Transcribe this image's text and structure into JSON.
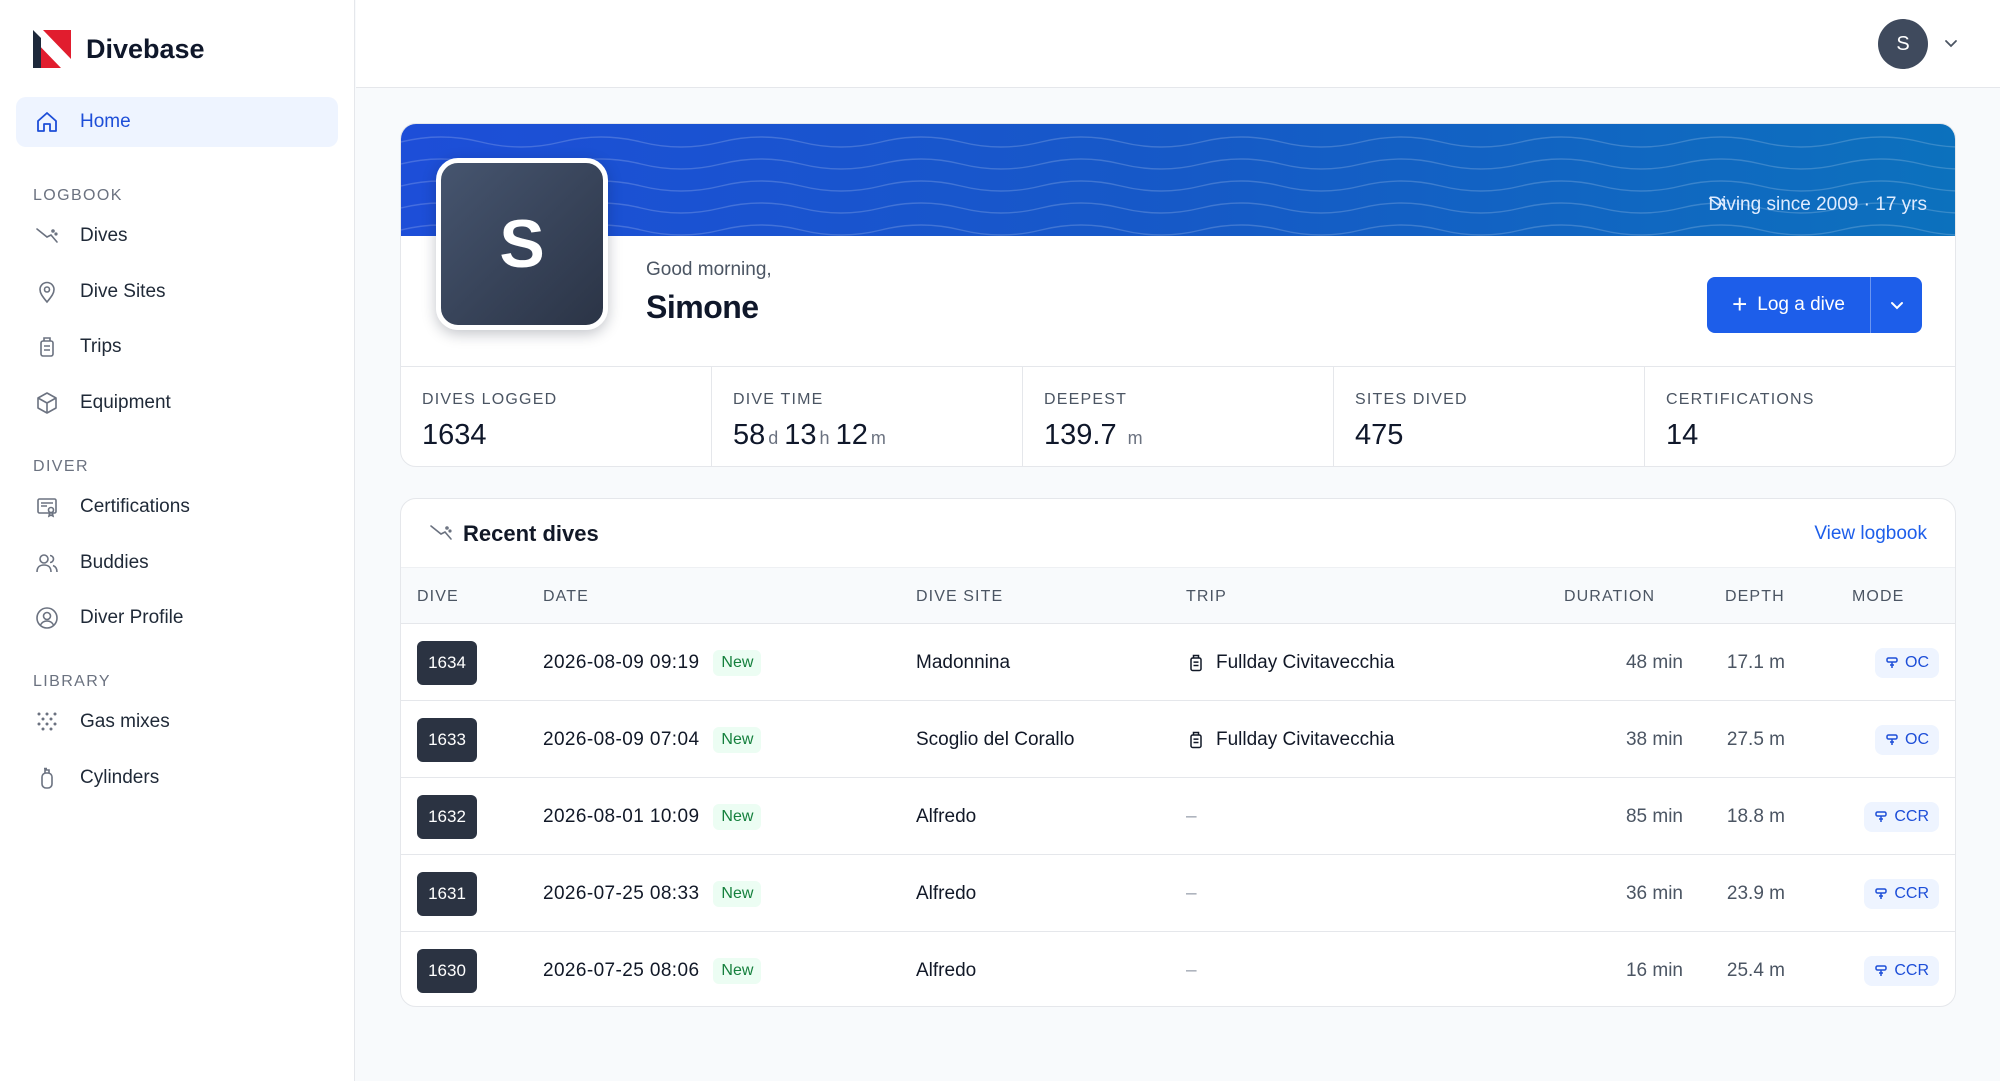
{
  "app": {
    "name": "Divebase"
  },
  "sidebar": {
    "home": {
      "label": "Home",
      "icon": "home-icon"
    },
    "sections": [
      {
        "title": "LOGBOOK",
        "items": [
          {
            "label": "Dives",
            "icon": "dive-icon"
          },
          {
            "label": "Dive Sites",
            "icon": "map-pin-icon"
          },
          {
            "label": "Trips",
            "icon": "luggage-icon"
          },
          {
            "label": "Equipment",
            "icon": "box-icon"
          }
        ]
      },
      {
        "title": "DIVER",
        "items": [
          {
            "label": "Certifications",
            "icon": "certificate-icon"
          },
          {
            "label": "Buddies",
            "icon": "users-icon"
          },
          {
            "label": "Diver Profile",
            "icon": "user-circle-icon"
          }
        ]
      },
      {
        "title": "LIBRARY",
        "items": [
          {
            "label": "Gas mixes",
            "icon": "gas-dots-icon"
          },
          {
            "label": "Cylinders",
            "icon": "cylinder-icon"
          }
        ]
      }
    ]
  },
  "topbar": {
    "avatar_initial": "S"
  },
  "profile": {
    "diving_since": "Diving since 2009 · 17 yrs",
    "avatar_initial": "S",
    "greeting": "Good morning,",
    "name": "Simone",
    "log_button": "Log a dive",
    "stats": [
      {
        "label": "DIVES LOGGED",
        "value": "1634"
      },
      {
        "label": "DIVE TIME",
        "parts": [
          [
            "58",
            "d"
          ],
          [
            "13",
            "h"
          ],
          [
            "12",
            "m"
          ]
        ]
      },
      {
        "label": "DEEPEST",
        "value": "139.7",
        "unit": "m"
      },
      {
        "label": "SITES DIVED",
        "value": "475"
      },
      {
        "label": "CERTIFICATIONS",
        "value": "14"
      }
    ]
  },
  "recent": {
    "title": "Recent dives",
    "view_link": "View logbook",
    "columns": {
      "dive": "DIVE",
      "date": "DATE",
      "site": "DIVE SITE",
      "trip": "TRIP",
      "duration": "DURATION",
      "depth": "DEPTH",
      "mode": "MODE"
    },
    "rows": [
      {
        "num": "1634",
        "date": "2026-08-09 09:19",
        "badge": "New",
        "site": "Madonnina",
        "trip": "Fullday Civitavecchia",
        "duration": "48 min",
        "depth": "17.1 m",
        "mode": "OC"
      },
      {
        "num": "1633",
        "date": "2026-08-09 07:04",
        "badge": "New",
        "site": "Scoglio del Corallo",
        "trip": "Fullday Civitavecchia",
        "duration": "38 min",
        "depth": "27.5 m",
        "mode": "OC"
      },
      {
        "num": "1632",
        "date": "2026-08-01 10:09",
        "badge": "New",
        "site": "Alfredo",
        "trip": "–",
        "duration": "85 min",
        "depth": "18.8 m",
        "mode": "CCR"
      },
      {
        "num": "1631",
        "date": "2026-07-25 08:33",
        "badge": "New",
        "site": "Alfredo",
        "trip": "–",
        "duration": "36 min",
        "depth": "23.9 m",
        "mode": "CCR"
      },
      {
        "num": "1630",
        "date": "2026-07-25 08:06",
        "badge": "New",
        "site": "Alfredo",
        "trip": "–",
        "duration": "16 min",
        "depth": "25.4 m",
        "mode": "CCR"
      }
    ]
  },
  "colors": {
    "accent": "#1d5eea",
    "banner": "#1659c7",
    "avatar": "#3f4a5d",
    "new_badge": "#15803d"
  }
}
